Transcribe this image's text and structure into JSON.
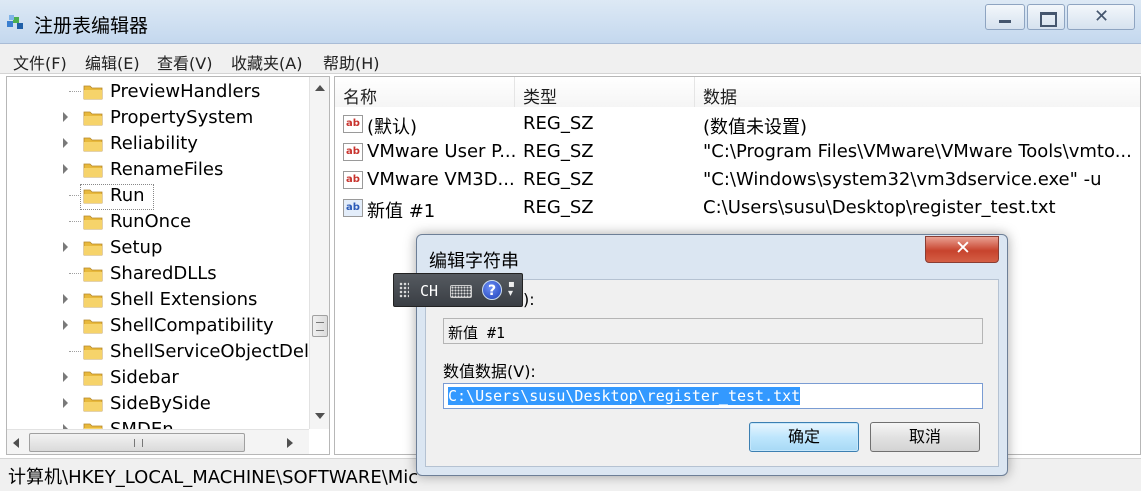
{
  "window": {
    "title": "注册表编辑器"
  },
  "menu": [
    "文件(F)",
    "编辑(E)",
    "查看(V)",
    "收藏夹(A)",
    "帮助(H)"
  ],
  "tree": {
    "items": [
      {
        "label": "PreviewHandlers",
        "expander": false
      },
      {
        "label": "PropertySystem",
        "expander": true
      },
      {
        "label": "Reliability",
        "expander": true
      },
      {
        "label": "RenameFiles",
        "expander": true
      },
      {
        "label": "Run",
        "expander": false,
        "selected": true
      },
      {
        "label": "RunOnce",
        "expander": false
      },
      {
        "label": "Setup",
        "expander": true
      },
      {
        "label": "SharedDLLs",
        "expander": false
      },
      {
        "label": "Shell Extensions",
        "expander": true
      },
      {
        "label": "ShellCompatibility",
        "expander": true
      },
      {
        "label": "ShellServiceObjectDela",
        "expander": false
      },
      {
        "label": "Sidebar",
        "expander": true
      },
      {
        "label": "SideBySide",
        "expander": true
      },
      {
        "label": "SMDEn",
        "expander": true
      }
    ]
  },
  "values": {
    "headers": {
      "name": "名称",
      "type": "类型",
      "data": "数据"
    },
    "rows": [
      {
        "icon": "string-value-icon",
        "name": "(默认)",
        "type": "REG_SZ",
        "data": "(数值未设置)"
      },
      {
        "icon": "string-value-icon",
        "name": "VMware User P...",
        "type": "REG_SZ",
        "data": "\"C:\\Program Files\\VMware\\VMware Tools\\vmto..."
      },
      {
        "icon": "string-value-icon",
        "name": "VMware VM3D...",
        "type": "REG_SZ",
        "data": "\"C:\\Windows\\system32\\vm3dservice.exe\" -u"
      },
      {
        "icon": "string-value-icon",
        "name": "新值 #1",
        "type": "REG_SZ",
        "data": "C:\\Users\\susu\\Desktop\\register_test.txt"
      }
    ]
  },
  "status": {
    "path": "计算机\\HKEY_LOCAL_MACHINE\\SOFTWARE\\Mic"
  },
  "ime": {
    "mode": "CH",
    "help": "?"
  },
  "dialog": {
    "title": "编辑字符串",
    "name_label": "N):",
    "name_value": "新值 #1",
    "data_label": "数值数据(V):",
    "data_value": "C:\\Users\\susu\\Desktop\\register_test.txt",
    "ok": "确定",
    "cancel": "取消"
  },
  "colors": {
    "selection": "#3399ff",
    "close_button": "#c7432d"
  }
}
